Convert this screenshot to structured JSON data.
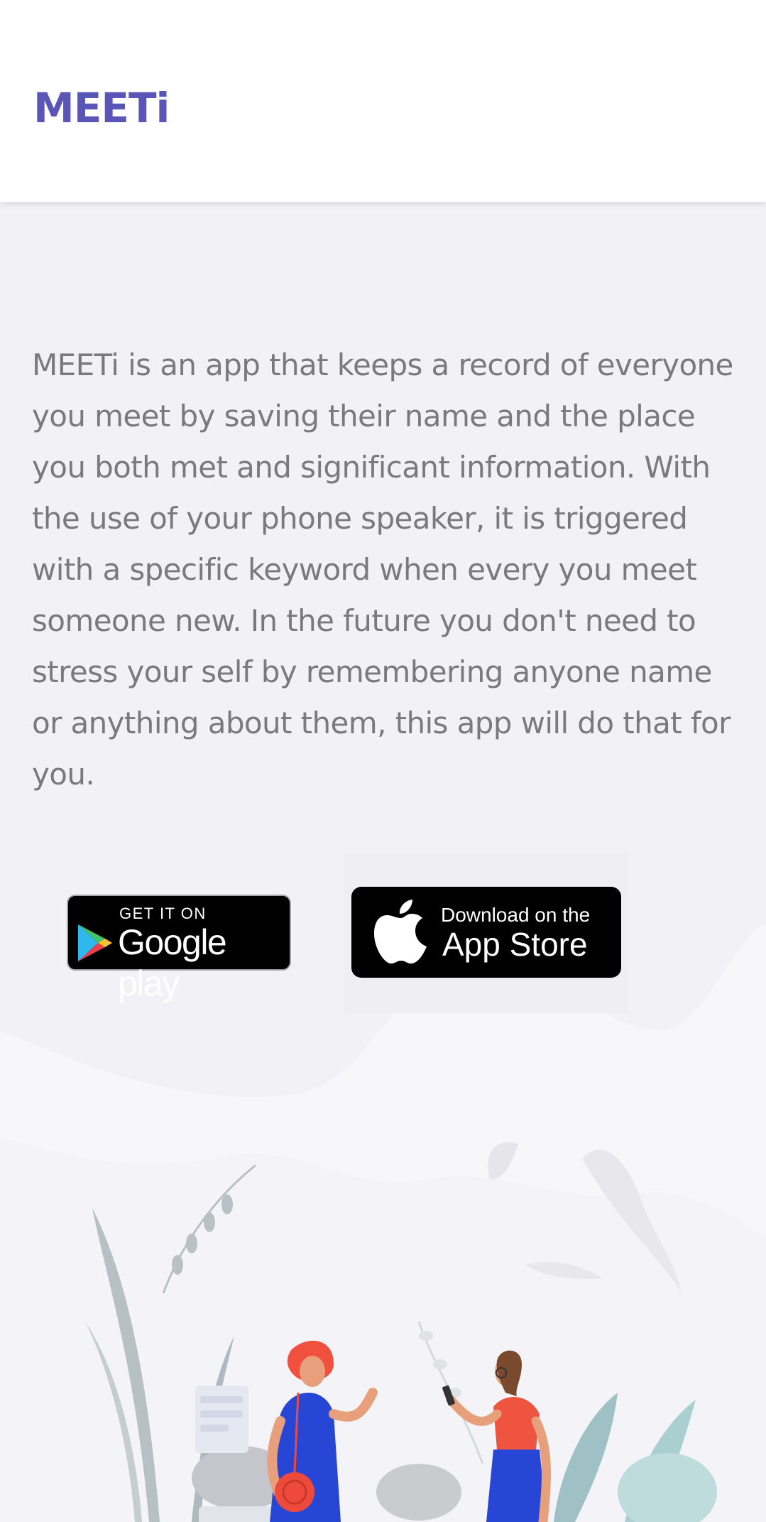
{
  "header": {
    "logo": "MEETi"
  },
  "main": {
    "description": "MEETi is an app that keeps a record of everyone you meet by saving their name and the place you both met and significant information. With the use of your phone speaker, it is triggered with a specific keyword when every you meet someone new. In the future you don't need to stress your self by remembering anyone name or anything about them, this app will do that for you."
  },
  "badges": {
    "google_play": {
      "top": "GET IT ON",
      "main": "Google play",
      "icon": "google-play-icon"
    },
    "app_store": {
      "top": "Download on the",
      "main": "App Store",
      "icon": "apple-icon"
    }
  },
  "colors": {
    "brand": "#5b55b8",
    "text": "#7a7a7e",
    "background": "#f2f2f6"
  }
}
